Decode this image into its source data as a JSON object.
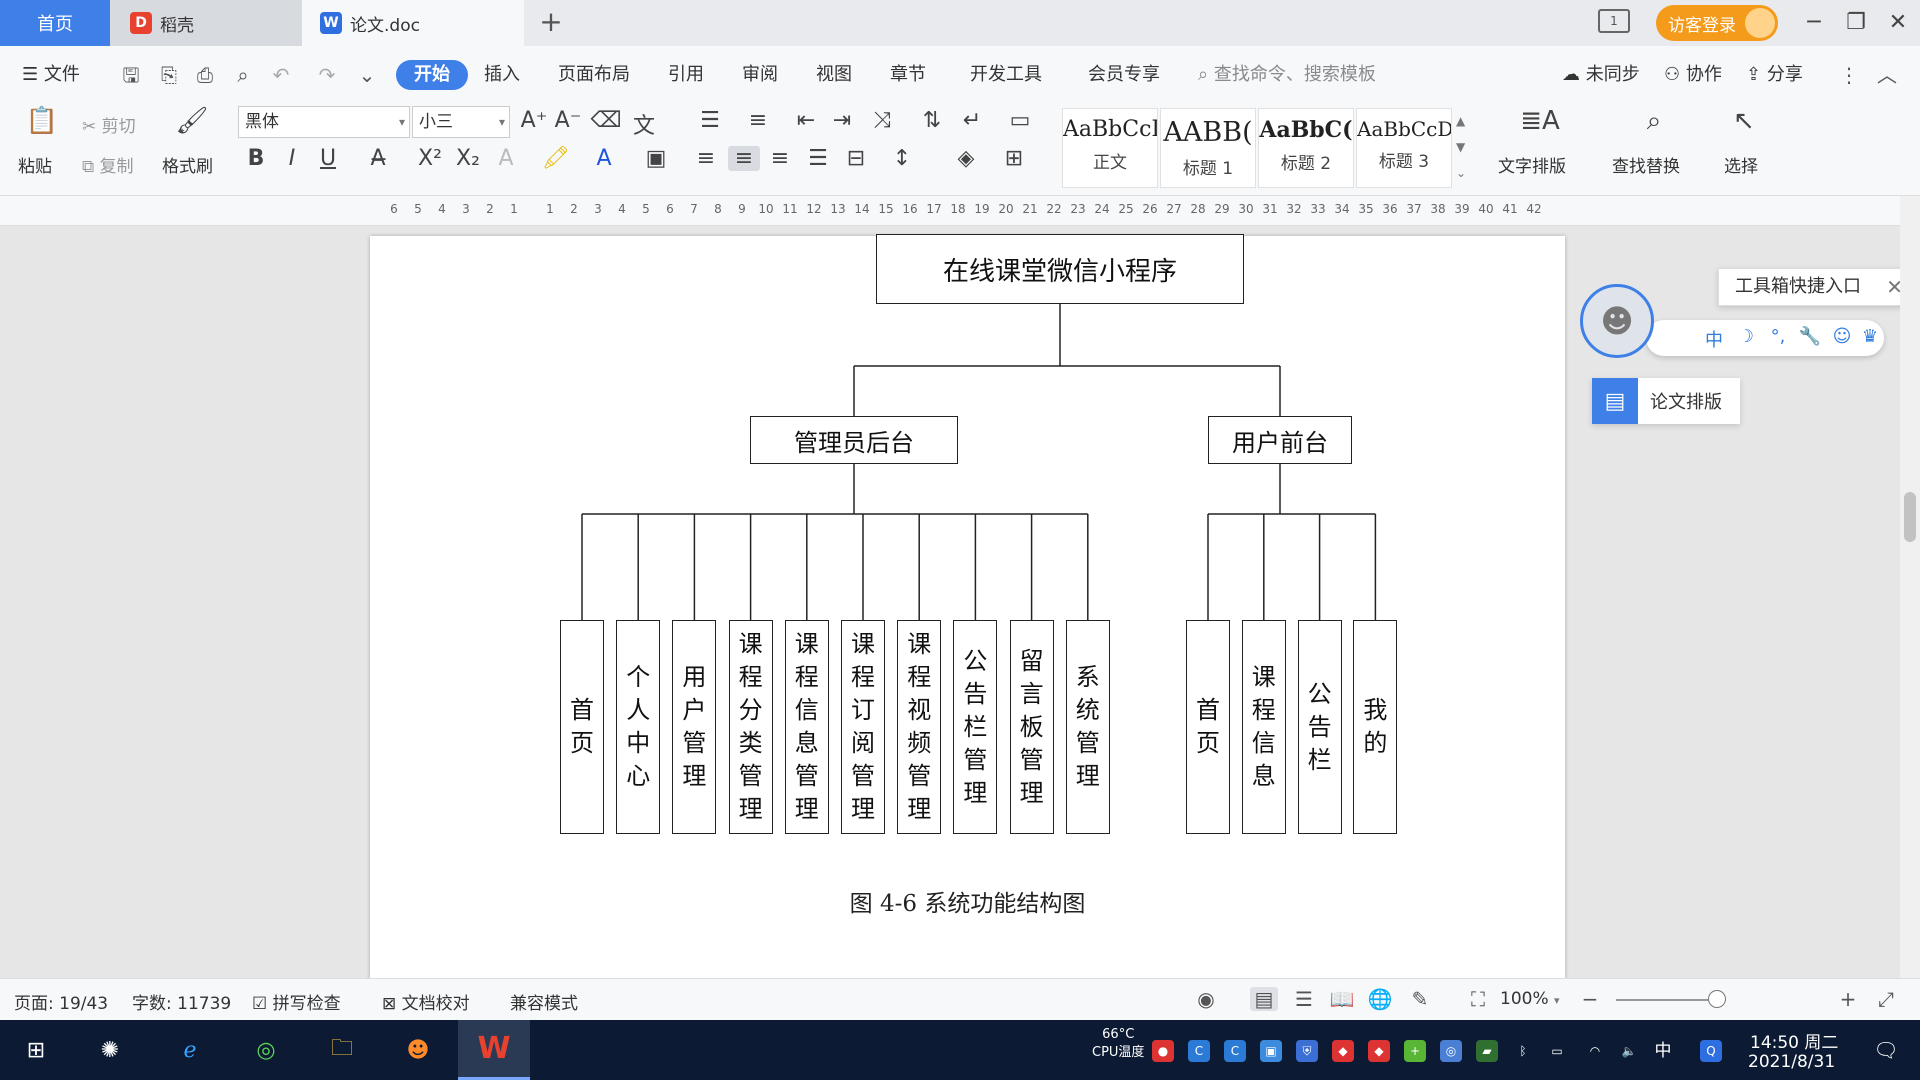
{
  "tabs": {
    "home": "首页",
    "daoke": "稻壳",
    "document": "论文.doc",
    "add_icon": "+"
  },
  "titlebar": {
    "visitor_login": "访客登录",
    "layout_badge": "1",
    "minimize_icon": "─",
    "restore_icon": "❐",
    "close_icon": "✕"
  },
  "menubar": {
    "file": "文件",
    "items": [
      "开始",
      "插入",
      "页面布局",
      "引用",
      "审阅",
      "视图",
      "章节",
      "开发工具",
      "会员专享"
    ],
    "search_placeholder": "查找命令、搜索模板",
    "unsynced": "未同步",
    "collaborate": "协作",
    "share": "分享"
  },
  "ribbon": {
    "paste": "粘贴",
    "cut": "剪切",
    "copy": "复制",
    "format_painter": "格式刷",
    "font_name": "黑体",
    "font_size": "小三",
    "styles": [
      {
        "sample": "AaBbCcI",
        "name": "正文"
      },
      {
        "sample": "AABB(",
        "name": "标题 1"
      },
      {
        "sample": "AaBbC(",
        "name": "标题 2"
      },
      {
        "sample": "AaBbCcDc",
        "name": "标题 3"
      }
    ],
    "text_layout": "文字排版",
    "find_replace": "查找替换",
    "select": "选择"
  },
  "ruler": {
    "left_ticks": [
      "6",
      "5",
      "4",
      "3",
      "2",
      "1"
    ],
    "right_ticks": [
      "1",
      "2",
      "3",
      "4",
      "5",
      "6",
      "7",
      "8",
      "9",
      "10",
      "11",
      "12",
      "13",
      "14",
      "15",
      "16",
      "17",
      "18",
      "19",
      "20",
      "21",
      "22",
      "23",
      "24",
      "25",
      "26",
      "27",
      "28",
      "29",
      "30",
      "31",
      "32",
      "33",
      "34",
      "35",
      "36",
      "37",
      "38",
      "39",
      "40",
      "41",
      "42"
    ]
  },
  "diagram": {
    "root": "在线课堂微信小程序",
    "admin": {
      "label": "管理员后台",
      "children": [
        "首页",
        "个人中心",
        "用户管理",
        "课程分类管理",
        "课程信息管理",
        "课程订阅管理",
        "课程视频管理",
        "公告栏管理",
        "留言板管理",
        "系统管理"
      ]
    },
    "user": {
      "label": "用户前台",
      "children": [
        "首页",
        "课程信息",
        "公告栏",
        "我的"
      ]
    },
    "caption": "图 4-6 系统功能结构图"
  },
  "widgets": {
    "toolbox_tip": "工具箱快捷入口",
    "toolbox_first": "中",
    "paper_layout": "论文排版"
  },
  "statusbar": {
    "page": "页面: 19/43",
    "words": "字数: 11739",
    "spell_check": "拼写检查",
    "doc_proof": "文档校对",
    "compat_mode": "兼容模式",
    "zoom": "100%"
  },
  "taskbar": {
    "cpu_temp": "66°C",
    "cpu_label": "CPU温度",
    "ime": "中",
    "time": "14:50 周二",
    "date": "2021/8/31"
  },
  "colors": {
    "accent": "#3f7fe8",
    "visitor": "#f59b1b",
    "taskbar": "#0c1b33"
  }
}
